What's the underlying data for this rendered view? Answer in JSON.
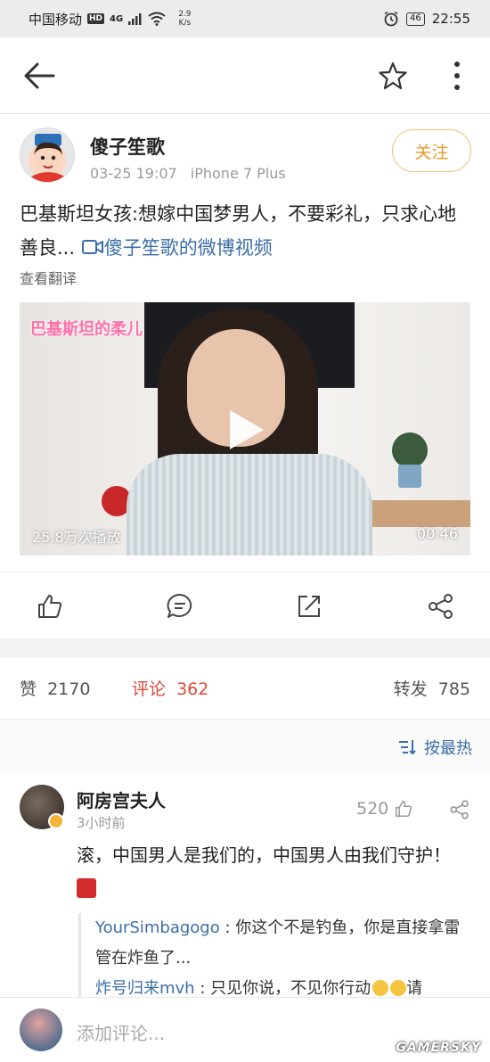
{
  "status_bar": {
    "carrier": "中国移动",
    "hd": "HD",
    "signal": "4G",
    "net_speed_value": "2.9",
    "net_speed_unit": "K/s",
    "battery": "46",
    "time": "22:55"
  },
  "post": {
    "author": "傻子笙歌",
    "date": "03-25 19:07",
    "device": "iPhone 7 Plus",
    "follow_label": "关注",
    "text": "巴基斯坦女孩:想嫁中国梦男人，不要彩礼，只求心地善良...",
    "video_link": "傻子笙歌的微博视频",
    "translate_label": "查看翻译",
    "video": {
      "caption": "巴基斯坦的柔儿",
      "views": "25.8万次播放",
      "duration": "00:46"
    }
  },
  "stats": {
    "likes_label": "赞",
    "likes": "2170",
    "comments_label": "评论",
    "comments": "362",
    "reposts_label": "转发",
    "reposts": "785"
  },
  "sort": {
    "label": "按最热"
  },
  "comment": {
    "name": "阿房宫夫人",
    "time": "3小时前",
    "likes": "520",
    "text": "滚，中国男人是我们的，中国男人由我们守护！",
    "replies": [
      {
        "user": "YourSimbagogo",
        "text": ": 你这个不是钓鱼，你是直接拿雷管在炸鱼了..."
      },
      {
        "user": "炸号归来mvh",
        "text": ": 只见你说，不见你行动",
        "text_tail": "请"
      }
    ]
  },
  "bottom": {
    "placeholder": "添加评论...",
    "watermark": "GAMERSKY"
  }
}
